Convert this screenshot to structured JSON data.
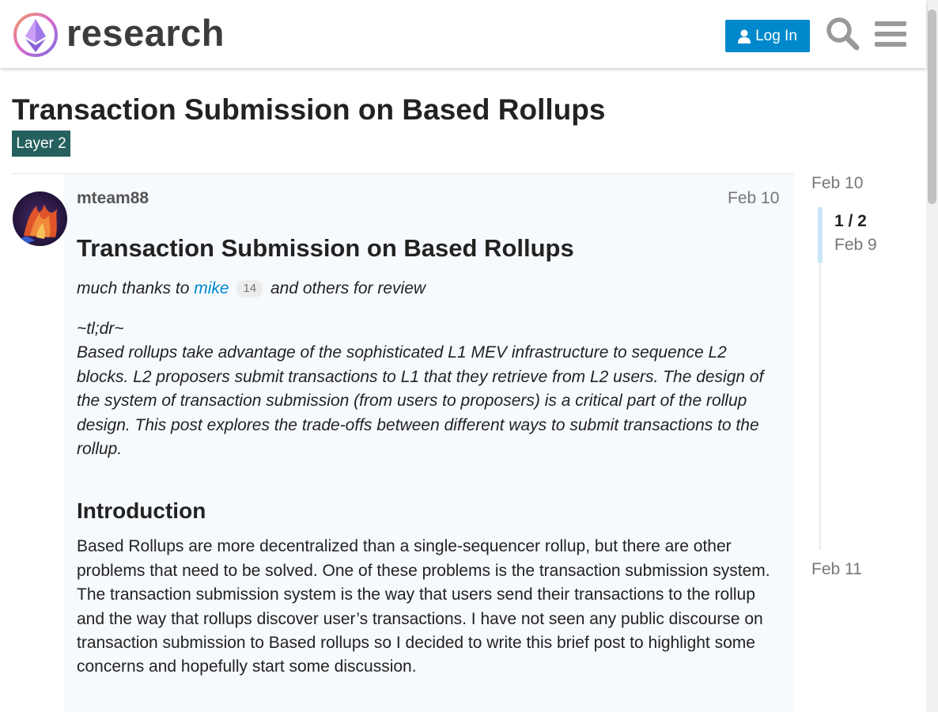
{
  "header": {
    "site_name": "research",
    "login_label": "Log In"
  },
  "topic": {
    "title": "Transaction Submission on Based Rollups",
    "category": "Layer 2",
    "category_color": "#25605f"
  },
  "post": {
    "username": "mteam88",
    "date": "Feb 10",
    "heading": "Transaction Submission on Based Rollups",
    "thanks_prefix": "much thanks to",
    "mention": "mike",
    "mention_count": "14",
    "thanks_suffix": "and others for review",
    "tldr_marker": "~tl;dr~",
    "tldr_text": "Based rollups take advantage of the sophisticated L1 MEV infrastructure to sequence L2 blocks. L2 proposers submit transactions to L1 that they retrieve from L2 users. The design of the system of transaction submission (from users to proposers) is a critical part of the rollup design. This post explores the trade-offs between different ways to submit transactions to the rollup.",
    "section_heading": "Introduction",
    "intro_text": "Based Rollups are more decentralized than a single-sequencer rollup, but there are other problems that need to be solved. One of these problems is the transaction submission system. The transaction submission system is the way that users send their transactions to the rollup and the way that rollups discover user’s transactions. I have not seen any public discourse on transaction submission to Based rollups so I decided to write this brief post to highlight some concerns and hopefully start some discussion."
  },
  "timeline": {
    "start_date": "Feb 10",
    "counter": "1 / 2",
    "current_date": "Feb 9",
    "end_date": "Feb 11",
    "progress": 0.5
  },
  "colors": {
    "accent": "#0088cc",
    "post_background": "#f6f9fd"
  },
  "icons": {
    "login": "user-icon",
    "search": "search-icon",
    "menu": "hamburger-menu-icon"
  }
}
